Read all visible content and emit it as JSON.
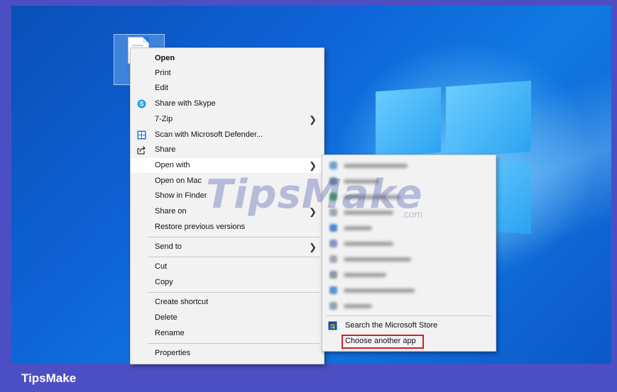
{
  "main_menu": {
    "items": [
      {
        "label": "Open",
        "bold": true
      },
      {
        "label": "Print"
      },
      {
        "label": "Edit"
      },
      {
        "label": "Share with Skype",
        "icon": "skype-icon"
      },
      {
        "label": "7-Zip",
        "submenu": true
      },
      {
        "label": "Scan with Microsoft Defender...",
        "icon": "defender-icon"
      },
      {
        "label": "Share",
        "icon": "share-icon"
      },
      {
        "label": "Open with",
        "submenu": true,
        "highlighted": true
      },
      {
        "label": "Open on Mac"
      },
      {
        "label": "Show in Finder"
      },
      {
        "label": "Share on",
        "submenu": true
      },
      {
        "label": "Restore previous versions"
      },
      {
        "label": "Send to",
        "submenu": true
      },
      {
        "label": "Cut"
      },
      {
        "label": "Copy"
      },
      {
        "label": "Create shortcut"
      },
      {
        "label": "Delete"
      },
      {
        "label": "Rename"
      },
      {
        "label": "Properties"
      }
    ]
  },
  "submenu": {
    "blurred_app_count": 10,
    "store_label": "Search the Microsoft Store",
    "choose_label": "Choose another app"
  },
  "watermark": {
    "text": "TipsMake",
    "suffix": ".com"
  },
  "brand": "TipsMake",
  "colors": {
    "frame": "#4c4fc3",
    "highlight_box": "#d0202a"
  }
}
